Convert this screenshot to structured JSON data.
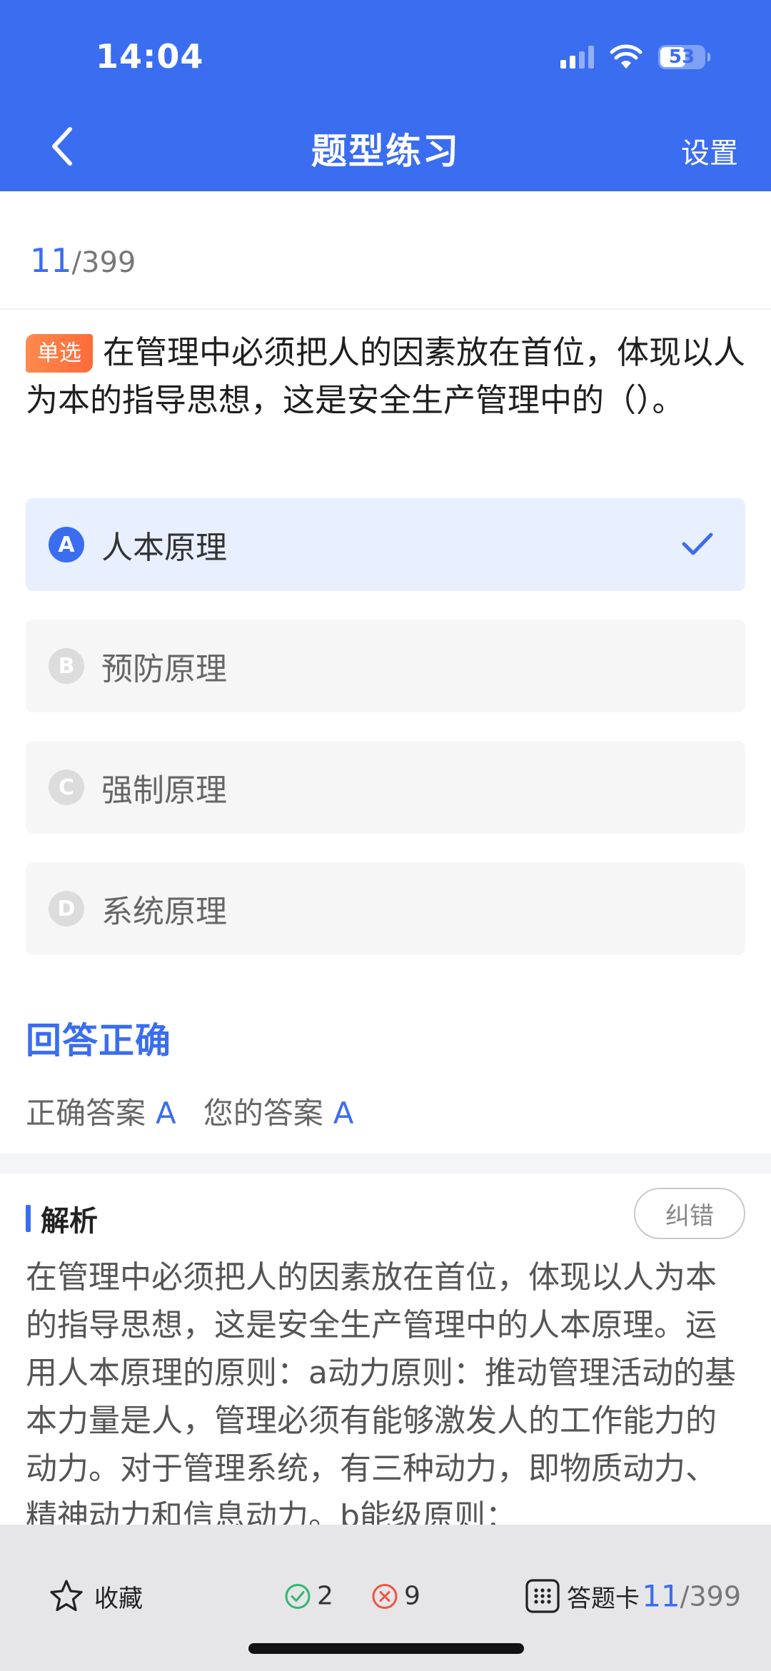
{
  "status_bar": {
    "time": "14:04",
    "battery": "53"
  },
  "nav": {
    "title": "题型练习",
    "settings_label": "设置"
  },
  "progress": {
    "current": "11",
    "total": "/399"
  },
  "question": {
    "type_badge": "单选",
    "text": "在管理中必须把人的因素放在首位，体现以人为本的指导思想，这是安全生产管理中的（）。"
  },
  "options": [
    {
      "letter": "A",
      "text": "人本原理"
    },
    {
      "letter": "B",
      "text": "预防原理"
    },
    {
      "letter": "C",
      "text": "强制原理"
    },
    {
      "letter": "D",
      "text": "系统原理"
    }
  ],
  "result": {
    "title": "回答正确",
    "correct_label": "正确答案",
    "correct_value": "A",
    "your_label": "您的答案",
    "your_value": "A"
  },
  "analysis": {
    "title": "解析",
    "report_label": "纠错",
    "text": "在管理中必须把人的因素放在首位，体现以人为本的指导思想，这是安全生产管理中的人本原理。运用人本原理的原则：a动力原则：推动管理活动的基本力量是人，管理必须有能够激发人的工作能力的动力。对于管理系统，有三种动力，即物质动力、精神动力和信息动力。b能级原则："
  },
  "bottom_bar": {
    "favorite_label": "收藏",
    "correct_count": "2",
    "wrong_count": "9",
    "answer_card_label": "答题卡",
    "progress_current": "11",
    "progress_total": "/399"
  },
  "colors": {
    "accent": "#3a6df0",
    "badge": "#ff6a3a",
    "correct": "#2eb872",
    "wrong": "#f0533f"
  }
}
